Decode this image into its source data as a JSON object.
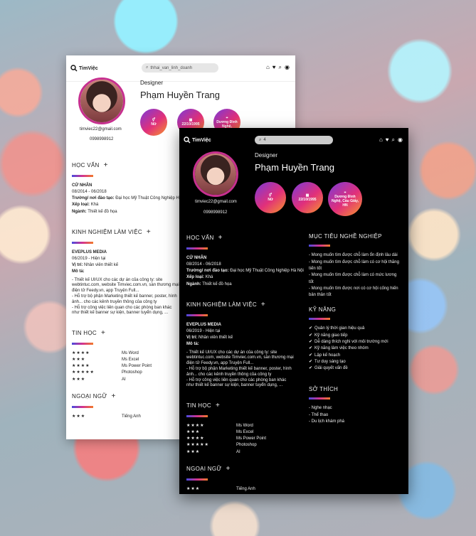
{
  "brand": "TimViệc",
  "search": {
    "light_value": "thhai_van_linh_doanh",
    "dark_value": "4"
  },
  "profile": {
    "role": "Designer",
    "name": "Phạm Huyền Trang",
    "email": "timviec22@gmail.com",
    "phone": "0998998912"
  },
  "badges": {
    "gender": "Nữ",
    "dob": "22/10/1995",
    "address_light": "Dương Đình Nghệ,",
    "address_dark": "Dương Đình Nghệ, Cầu Giấy, HN"
  },
  "education": {
    "title": "HỌC VẤN",
    "subject": "CỬ NHÂN",
    "period": "08/2014 - 06/2018",
    "school_label": "Trường/ nơi đào tạo:",
    "school": "Đại học Mỹ Thuật Công Nghiệp Hà Nội",
    "rank_label": "Xếp loại:",
    "rank": "Khá",
    "major_label": "Ngành:",
    "major": "Thiết kế đồ họa"
  },
  "experience": {
    "title": "KINH NGHIỆM LÀM VIỆC",
    "company": "EVEPLUS MEDIA",
    "period": "06/2019 - Hiện tại",
    "position_label": "Vị trí:",
    "position": "Nhân viên thiết kế",
    "desc_label": "Mô tả:",
    "desc": "- Thiết kế UI/UX cho các dự án của công ty: site webtintuc.com, website Timviec.com.vn, sàn thương mại điện tử Feedy.vn, app Truyện Full...\n- Hỗ trợ bộ phận Marketing thiết kế banner, poster, hình ảnh... cho các kênh truyền thông của công ty\n- Hỗ trợ công việc liên quan cho các phòng ban khác như thiết kế banner sự kiện, banner tuyển dụng, ..."
  },
  "it": {
    "title": "TIN HỌC",
    "items": [
      {
        "stars": "★★★★",
        "name": "Ms Word"
      },
      {
        "stars": "★★★",
        "name": "Ms Excel"
      },
      {
        "stars": "★★★★",
        "name": "Ms Power Point"
      },
      {
        "stars": "★★★★★",
        "name": "Photoshop"
      },
      {
        "stars": "★★★",
        "name": "AI"
      }
    ]
  },
  "language": {
    "title": "NGOẠI NGỮ",
    "items": [
      {
        "stars": "★★★",
        "name": "Tiếng Anh"
      }
    ]
  },
  "goal": {
    "title": "MỤC TIÊU NGHỀ NGHIỆP",
    "lines": [
      "- Mong muốn tìm được chỗ làm ổn định lâu dài",
      "- Mong muốn tìm được chỗ làm có cơ hội thăng tiến tốt",
      "- Mong muốn tìm được chỗ làm có mức lương tốt",
      "- Mong muốn tìm được nơi có cơ hội cống hiến bản thân tốt"
    ]
  },
  "skills": {
    "title": "KỸ NĂNG",
    "items": [
      "Quản lý thời gian hiệu quả",
      "Kỹ năng giao tiếp",
      "Dễ dàng thích nghi với môi trường mới",
      "Kỹ năng làm việc theo nhóm",
      "Lập kế hoạch",
      "Tư duy sáng tạo",
      "Giải quyết vấn đề"
    ]
  },
  "hobby": {
    "title": "SỞ THÍCH",
    "items": [
      "- Nghe nhạc",
      "- Thể thao",
      "- Du lịch khám phá"
    ]
  },
  "colors": {
    "accent_start": "#4a4adf",
    "accent_mid": "#d3338f",
    "accent_end": "#f27a2b"
  }
}
